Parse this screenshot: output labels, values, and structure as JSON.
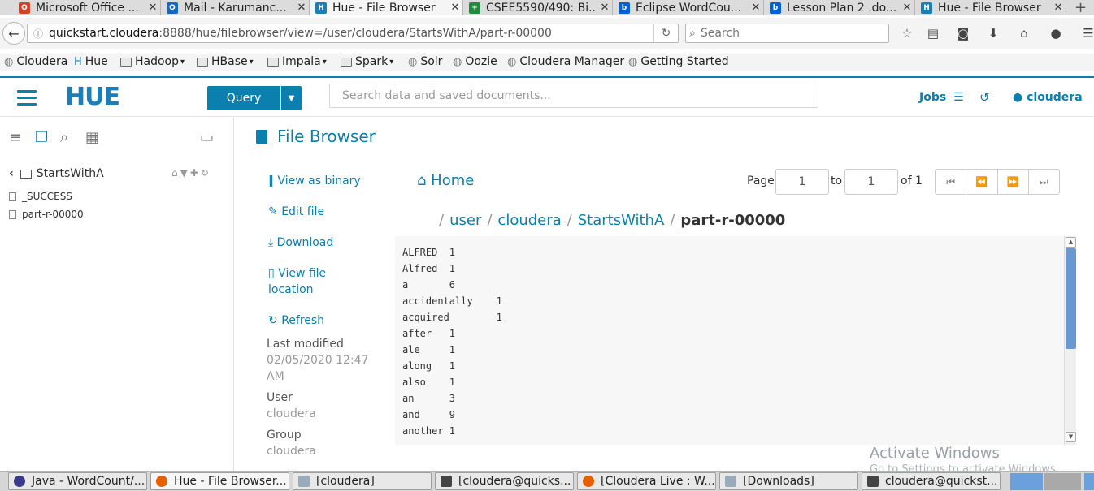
{
  "browser": {
    "tabs": [
      {
        "label": "Microsoft Office ...",
        "icon": "office-icon",
        "color": "#d04525",
        "active": false
      },
      {
        "label": "Mail - Karumanc...",
        "icon": "outlook-icon",
        "color": "#1669c1",
        "active": false
      },
      {
        "label": "Hue - File Browser",
        "icon": "hue-icon",
        "color": "#1a7fb8",
        "active": true
      },
      {
        "label": "CSEE5590/490: Bi...",
        "icon": "sheets-icon",
        "color": "#1e8e3e",
        "active": false
      },
      {
        "label": "Eclipse WordCou...",
        "icon": "box-icon",
        "color": "#0061d5",
        "active": false
      },
      {
        "label": "Lesson Plan 2 .do...",
        "icon": "box-icon",
        "color": "#0061d5",
        "active": false
      },
      {
        "label": "Hue - File Browser",
        "icon": "hue-icon",
        "color": "#1a7fb8",
        "active": false
      }
    ],
    "url_host": "quickstart.cloudera",
    "url_path": ":8888/hue/filebrowser/view=/user/cloudera/StartsWithA/part-r-00000",
    "search_placeholder": "Search",
    "bookmarks": [
      {
        "label": "Cloudera",
        "type": "site"
      },
      {
        "label": "Hue",
        "type": "site"
      },
      {
        "label": "Hadoop",
        "type": "folder"
      },
      {
        "label": "HBase",
        "type": "folder"
      },
      {
        "label": "Impala",
        "type": "folder"
      },
      {
        "label": "Spark",
        "type": "folder"
      },
      {
        "label": "Solr",
        "type": "site"
      },
      {
        "label": "Oozie",
        "type": "site"
      },
      {
        "label": "Cloudera Manager",
        "type": "site"
      },
      {
        "label": "Getting Started",
        "type": "site"
      }
    ]
  },
  "hue": {
    "logo": "HUE",
    "query_label": "Query",
    "search_placeholder": "Search data and saved documents...",
    "jobs_label": "Jobs",
    "user_label": "cloudera",
    "brand_color": "#0b7fad"
  },
  "leftpanel": {
    "folder": "StartsWithA",
    "files": [
      "_SUCCESS",
      "part-r-00000"
    ]
  },
  "main": {
    "title": "File Browser",
    "actions": {
      "view_binary": "View as binary",
      "edit_file": "Edit file",
      "download": "Download",
      "view_location_1": "View file",
      "view_location_2": "location",
      "refresh": "Refresh"
    },
    "meta": {
      "last_modified_label": "Last modified",
      "last_modified_1": "02/05/2020 12:47",
      "last_modified_2": "AM",
      "user_label": "User",
      "user_value": "cloudera",
      "group_label": "Group",
      "group_value": "cloudera"
    },
    "home_label": "Home",
    "page_label": "Page",
    "page_from": "1",
    "to_label": "to",
    "page_to": "1",
    "of_label": "of 1",
    "breadcrumb": {
      "user": "user",
      "cloudera": "cloudera",
      "folder": "StartsWithA",
      "file": "part-r-00000"
    },
    "file_lines": [
      "ALFRED  1",
      "Alfred  1",
      "a       6",
      "accidentally    1",
      "acquired        1",
      "after   1",
      "ale     1",
      "along   1",
      "also    1",
      "an      3",
      "and     9",
      "another 1"
    ]
  },
  "watermark": {
    "title": "Activate Windows",
    "subtitle": "Go to Settings to activate Windows."
  },
  "taskbar": [
    {
      "label": "Java - WordCount/...",
      "active": false
    },
    {
      "label": "Hue - File Browser...",
      "active": true
    },
    {
      "label": "[cloudera]",
      "active": false
    },
    {
      "label": "[cloudera@quicks...",
      "active": false
    },
    {
      "label": "[Cloudera Live : W...",
      "active": false
    },
    {
      "label": "[Downloads]",
      "active": false
    },
    {
      "label": "cloudera@quickst...",
      "active": false
    }
  ]
}
